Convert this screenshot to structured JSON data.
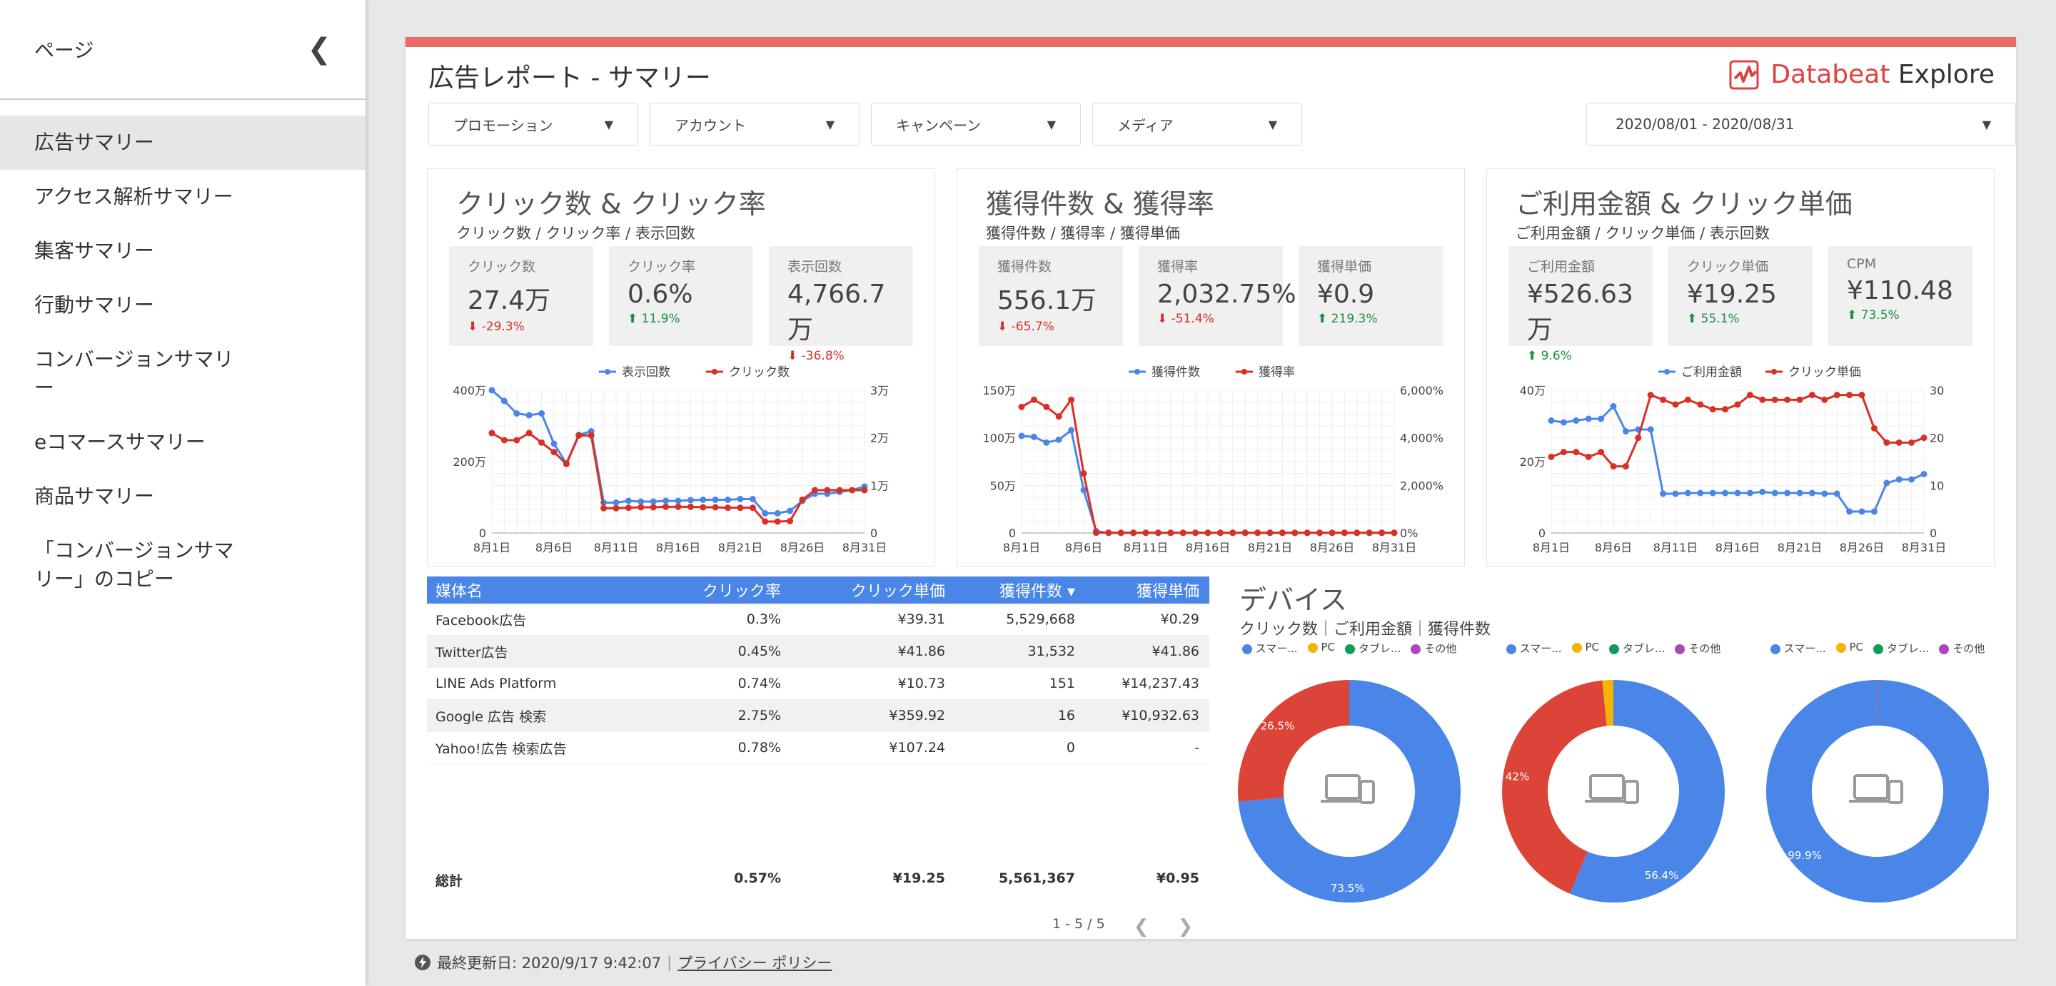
{
  "sidebar": {
    "title": "ページ",
    "items": [
      {
        "label": "広告サマリー",
        "active": true
      },
      {
        "label": "アクセス解析サマリー"
      },
      {
        "label": "集客サマリー"
      },
      {
        "label": "行動サマリー"
      },
      {
        "label": "コンバージョンサマリー"
      },
      {
        "label": "eコマースサマリー"
      },
      {
        "label": "商品サマリー"
      },
      {
        "label": "「コンバージョンサマリー」のコピー"
      }
    ]
  },
  "report": {
    "title": "広告レポート - サマリー",
    "logo_brand": "Databeat",
    "logo_suffix": "Explore",
    "filters": [
      "プロモーション",
      "アカウント",
      "キャンペーン",
      "メディア"
    ],
    "date_range": "2020/08/01 - 2020/08/31"
  },
  "panels": [
    {
      "title": "クリック数 & クリック率",
      "subtitle": "クリック数 / クリック率 / 表示回数",
      "cards": [
        {
          "label": "クリック数",
          "value": "27.4万",
          "delta": "-29.3%",
          "dir": "down"
        },
        {
          "label": "クリック率",
          "value": "0.6%",
          "delta": "11.9%",
          "dir": "up"
        },
        {
          "label": "表示回数",
          "value": "4,766.7万",
          "delta": "-36.8%",
          "dir": "down"
        }
      ]
    },
    {
      "title": "獲得件数 & 獲得率",
      "subtitle": "獲得件数 / 獲得率 / 獲得単価",
      "cards": [
        {
          "label": "獲得件数",
          "value": "556.1万",
          "delta": "-65.7%",
          "dir": "down"
        },
        {
          "label": "獲得率",
          "value": "2,032.75%",
          "delta": "-51.4%",
          "dir": "down"
        },
        {
          "label": "獲得単価",
          "value": "¥0.9",
          "delta": "219.3%",
          "dir": "up"
        }
      ]
    },
    {
      "title": "ご利用金額 & クリック単価",
      "subtitle": "ご利用金額 / クリック単価 / 表示回数",
      "cards": [
        {
          "label": "ご利用金額",
          "value": "¥526.63万",
          "delta": "9.6%",
          "dir": "up"
        },
        {
          "label": "クリック単価",
          "value": "¥19.25",
          "delta": "55.1%",
          "dir": "up"
        },
        {
          "label": "CPM",
          "value": "¥110.48",
          "delta": "73.5%",
          "dir": "up"
        }
      ]
    }
  ],
  "chart_data": [
    {
      "type": "line",
      "x_ticks": [
        "8月1日",
        "8月6日",
        "8月11日",
        "8月16日",
        "8月21日",
        "8月26日",
        "8月31日"
      ],
      "y_left_ticks": [
        "0",
        "200万",
        "400万"
      ],
      "y_right_ticks": [
        "0",
        "1万",
        "2万",
        "3万"
      ],
      "ylim_left": [
        0,
        4000000
      ],
      "ylim_right": [
        0,
        30000
      ],
      "series": [
        {
          "name": "表示回数",
          "axis": "left",
          "color": "#4a86e8",
          "values": [
            4000000,
            3700000,
            3350000,
            3300000,
            3350000,
            2500000,
            1950000,
            2750000,
            2850000,
            850000,
            850000,
            900000,
            880000,
            880000,
            900000,
            900000,
            920000,
            930000,
            930000,
            930000,
            950000,
            950000,
            550000,
            550000,
            620000,
            900000,
            1100000,
            1100000,
            1150000,
            1200000,
            1300000
          ]
        },
        {
          "name": "クリック数",
          "axis": "right",
          "color": "#d93025",
          "values": [
            21000,
            19500,
            19500,
            21000,
            19000,
            17000,
            14500,
            20500,
            20500,
            5200,
            5200,
            5300,
            5400,
            5400,
            5500,
            5500,
            5500,
            5400,
            5400,
            5300,
            5300,
            5300,
            2400,
            2400,
            2500,
            7000,
            9000,
            9000,
            9000,
            9000,
            9000
          ]
        }
      ]
    },
    {
      "type": "line",
      "x_ticks": [
        "8月1日",
        "8月6日",
        "8月11日",
        "8月16日",
        "8月21日",
        "8月26日",
        "8月31日"
      ],
      "y_left_ticks": [
        "0",
        "50万",
        "100万",
        "150万"
      ],
      "y_right_ticks": [
        "0%",
        "2,000%",
        "4,000%",
        "6,000%"
      ],
      "ylim_left": [
        0,
        1500000
      ],
      "ylim_right": [
        0,
        6000
      ],
      "series": [
        {
          "name": "獲得件数",
          "axis": "left",
          "color": "#4a86e8",
          "values": [
            1020000,
            1010000,
            950000,
            980000,
            1080000,
            450000,
            20000,
            0,
            0,
            0,
            0,
            0,
            0,
            0,
            0,
            0,
            0,
            0,
            0,
            0,
            0,
            0,
            0,
            0,
            0,
            0,
            0,
            0,
            0,
            0,
            0
          ]
        },
        {
          "name": "獲得率",
          "axis": "right",
          "color": "#d93025",
          "values": [
            5300,
            5600,
            5300,
            4900,
            5600,
            2500,
            10,
            10,
            10,
            10,
            10,
            10,
            10,
            10,
            10,
            10,
            10,
            10,
            10,
            10,
            10,
            10,
            10,
            10,
            10,
            10,
            10,
            10,
            10,
            10,
            10
          ]
        }
      ]
    },
    {
      "type": "line",
      "x_ticks": [
        "8月1日",
        "8月6日",
        "8月11日",
        "8月16日",
        "8月21日",
        "8月26日",
        "8月31日"
      ],
      "y_left_ticks": [
        "0",
        "20万",
        "40万"
      ],
      "y_right_ticks": [
        "0",
        "10",
        "20",
        "30"
      ],
      "ylim_left": [
        0,
        400000
      ],
      "ylim_right": [
        0,
        30
      ],
      "series": [
        {
          "name": "ご利用金額",
          "axis": "left",
          "color": "#4a86e8",
          "values": [
            315000,
            310000,
            315000,
            320000,
            320000,
            355000,
            285000,
            290000,
            290000,
            110000,
            110000,
            112000,
            112000,
            112000,
            112000,
            112000,
            112000,
            115000,
            112000,
            112000,
            112000,
            112000,
            110000,
            110000,
            60000,
            60000,
            60000,
            140000,
            150000,
            150000,
            165000
          ]
        },
        {
          "name": "クリック単価",
          "axis": "right",
          "color": "#d93025",
          "values": [
            16,
            17,
            17,
            16,
            17,
            14,
            14,
            20,
            29,
            28,
            27,
            28,
            27,
            26,
            26,
            27,
            29,
            28,
            28,
            28,
            28,
            29,
            28,
            29,
            29,
            29,
            22,
            19,
            19,
            19,
            20
          ]
        }
      ]
    }
  ],
  "table": {
    "headers": [
      "媒体名",
      "クリック率",
      "クリック単価",
      "獲得件数 ▾",
      "獲得単価"
    ],
    "rows": [
      [
        "Facebook広告",
        "0.3%",
        "¥39.31",
        "5,529,668",
        "¥0.29"
      ],
      [
        "Twitter広告",
        "0.45%",
        "¥41.86",
        "31,532",
        "¥41.86"
      ],
      [
        "LINE Ads Platform",
        "0.74%",
        "¥10.73",
        "151",
        "¥14,237.43"
      ],
      [
        "Google 広告 検索",
        "2.75%",
        "¥359.92",
        "16",
        "¥10,932.63"
      ],
      [
        "Yahoo!広告 検索広告",
        "0.78%",
        "¥107.24",
        "0",
        "-"
      ]
    ],
    "total": [
      "総計",
      "0.57%",
      "¥19.25",
      "5,561,367",
      "¥0.95"
    ],
    "pagination": "1 - 5 / 5"
  },
  "devices": {
    "title": "デバイス",
    "subtitle": "クリック数｜ご利用金額｜獲得件数",
    "categories": [
      "スマー...",
      "PC",
      "タブレ...",
      "その他"
    ],
    "colors": [
      "#4a86e8",
      "#db4437",
      "#f4b400",
      "#0f9d58",
      "#ab47bc"
    ],
    "donuts": [
      {
        "values": [
          73.5,
          26.5,
          0,
          0,
          0
        ],
        "labels": [
          "73.5%",
          "26.5%"
        ]
      },
      {
        "values": [
          56.4,
          42,
          1.6,
          0,
          0
        ],
        "labels": [
          "56.4%",
          "42%"
        ]
      },
      {
        "values": [
          99.9,
          0.1,
          0,
          0,
          0
        ],
        "labels": [
          "99.9%"
        ]
      }
    ]
  },
  "footer": {
    "updated": "最終更新日: 2020/9/17 9:42:07",
    "privacy": "プライバシー ポリシー"
  }
}
